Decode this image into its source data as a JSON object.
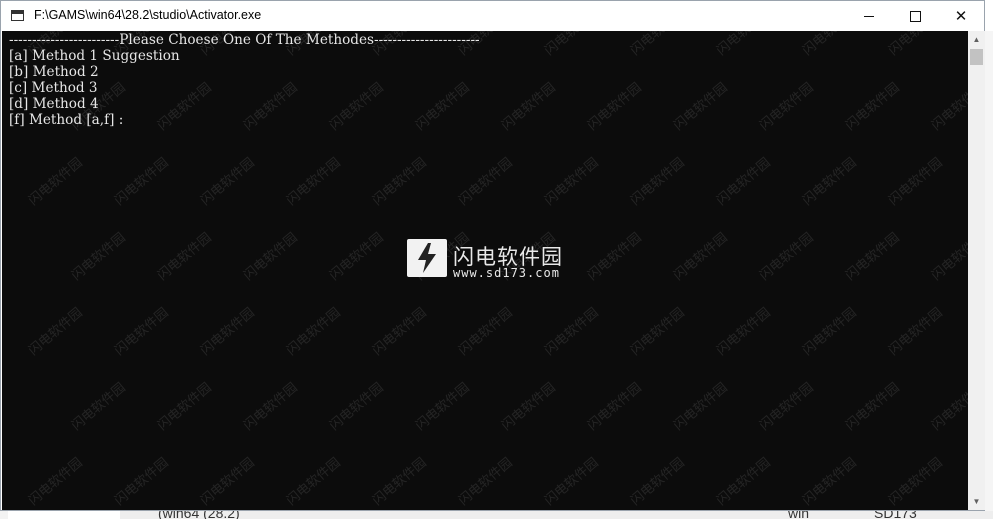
{
  "window": {
    "title": "F:\\GAMS\\win64\\28.2\\studio\\Activator.exe",
    "controls": {
      "minimize": "",
      "maximize": "",
      "close": "✕"
    }
  },
  "console": {
    "lines": [
      "------------------------Please Choese One Of The Methodes-----------------------",
      "[a] Method 1 Suggestion",
      "[b] Method 2",
      "[c] Method 3",
      "[d] Method 4",
      "[f] Method [a,f] :"
    ],
    "text_color": "#e6e6e6",
    "background_color": "#0c0c0c"
  },
  "watermark": {
    "brand": "闪电软件园",
    "url": "www.sd173.com",
    "tile_text": "闪电软件园"
  },
  "background": {
    "taskbar_text_1": "(win64 (28.2)",
    "taskbar_text_2": "win",
    "taskbar_text_3": "SD173"
  },
  "scrollbar": {
    "up_glyph": "▲",
    "down_glyph": "▼"
  }
}
